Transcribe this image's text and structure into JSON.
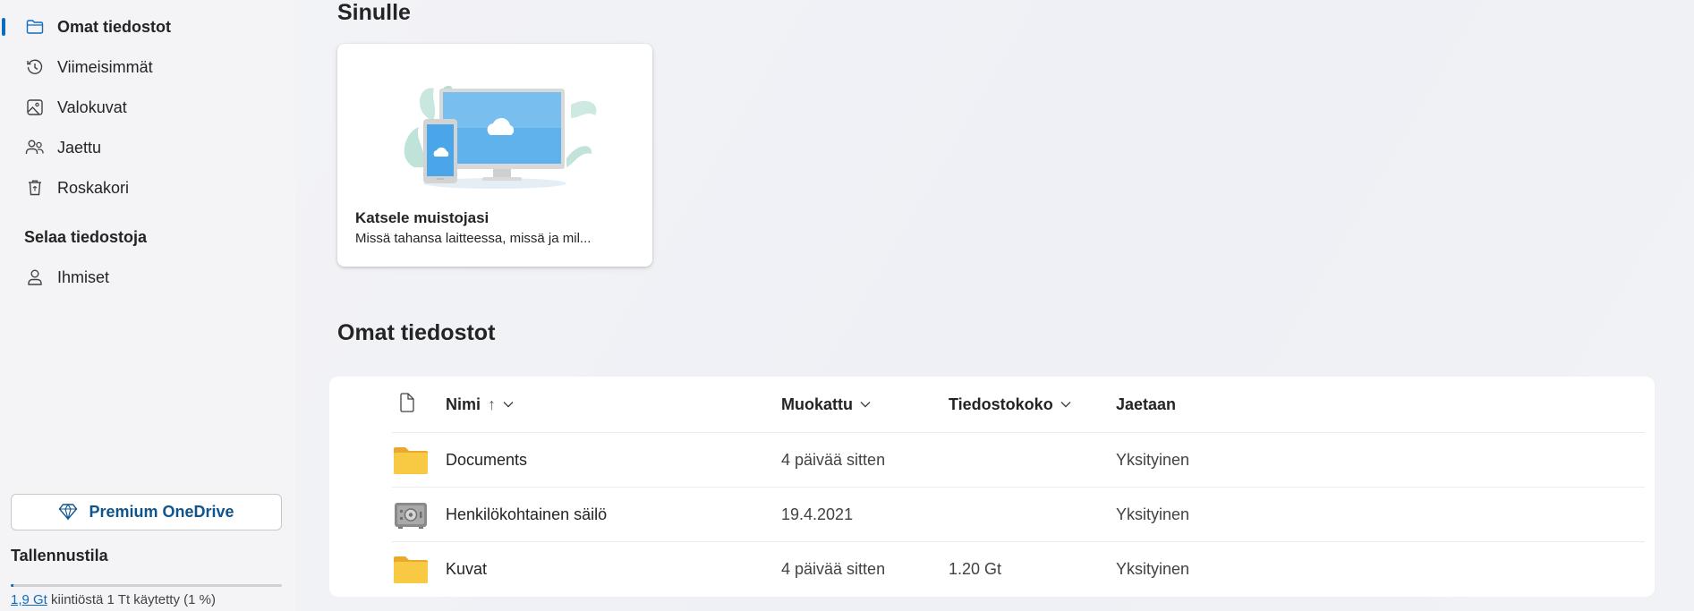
{
  "sidebar": {
    "items": [
      {
        "label": "Omat tiedostot",
        "icon": "folder-icon",
        "active": true
      },
      {
        "label": "Viimeisimmät",
        "icon": "history-icon"
      },
      {
        "label": "Valokuvat",
        "icon": "photo-icon"
      },
      {
        "label": "Jaettu",
        "icon": "people-icon"
      },
      {
        "label": "Roskakori",
        "icon": "recycle-bin-icon"
      }
    ],
    "browse_title": "Selaa tiedostoja",
    "browse_items": [
      {
        "label": "Ihmiset",
        "icon": "person-icon"
      }
    ],
    "premium_label": "Premium OneDrive",
    "storage": {
      "title": "Tallennustila",
      "used_link": "1,9 Gt",
      "used_suffix": " kiintiöstä 1 Tt käytetty (1 %)",
      "used_percent": 1
    }
  },
  "main": {
    "for_you_title": "Sinulle",
    "card": {
      "title": "Katsele muistojasi",
      "subtitle": "Missä tahansa laitteessa, missä ja mil..."
    },
    "files_title": "Omat tiedostot",
    "columns": {
      "name": "Nimi",
      "name_sort": "↑",
      "modified": "Muokattu",
      "size": "Tiedostokoko",
      "sharing": "Jaetaan"
    },
    "rows": [
      {
        "name": "Documents",
        "icon": "folder-icon",
        "modified": "4 päivää sitten",
        "size": "",
        "sharing": "Yksityinen"
      },
      {
        "name": "Henkilökohtainen säilö",
        "icon": "vault-icon",
        "modified": "19.4.2021",
        "size": "",
        "sharing": "Yksityinen"
      },
      {
        "name": "Kuvat",
        "icon": "folder-icon",
        "modified": "4 päivää sitten",
        "size": "1.20 Gt",
        "sharing": "Yksityinen"
      }
    ]
  },
  "colors": {
    "accent": "#0f6cbd",
    "folder": "#f8c942"
  }
}
